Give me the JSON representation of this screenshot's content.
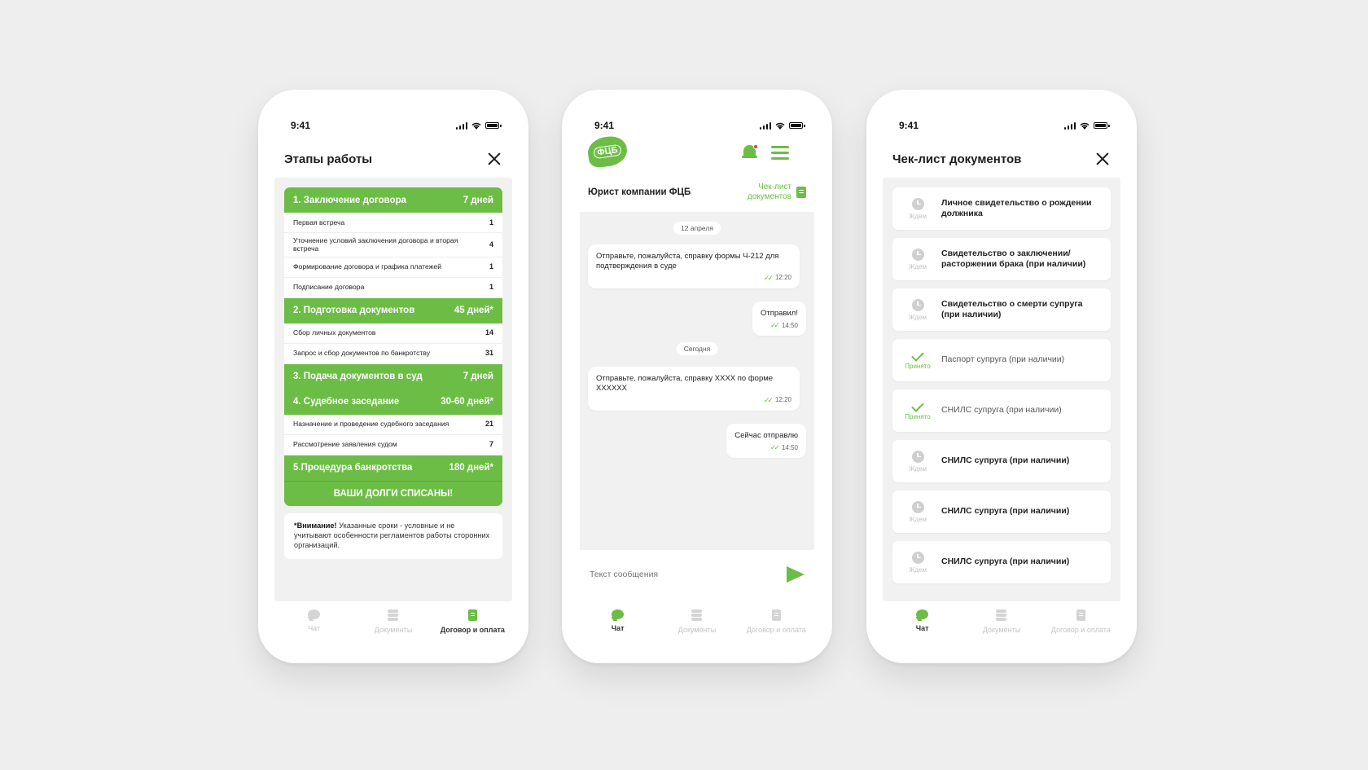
{
  "status": {
    "time": "9:41"
  },
  "tabs": {
    "chat": "Чат",
    "documents": "Документы",
    "contract": "Договор и оплата"
  },
  "stages_screen": {
    "title": "Этапы работы",
    "stages": [
      {
        "title": "1. Заключение договора",
        "days": "7 дней",
        "rows": [
          {
            "label": "Первая встреча",
            "n": "1"
          },
          {
            "label": "Уточнение условий заключения договора и вторая встреча",
            "n": "4"
          },
          {
            "label": "Формирование договора и графика платежей",
            "n": "1"
          },
          {
            "label": "Подписание договора",
            "n": "1"
          }
        ]
      },
      {
        "title": "2. Подготовка документов",
        "days": "45 дней*",
        "rows": [
          {
            "label": "Сбор личных документов",
            "n": "14"
          },
          {
            "label": "Запрос и сбор документов по банкротству",
            "n": "31"
          }
        ]
      },
      {
        "title": "3. Подача документов в суд",
        "days": "7 дней",
        "rows": []
      },
      {
        "title": "4. Судебное заседание",
        "days": "30-60 дней*",
        "rows": [
          {
            "label": "Назначение и проведение судебного заседания",
            "n": "21"
          },
          {
            "label": "Рассмотрение заявления судом",
            "n": "7"
          }
        ]
      },
      {
        "title": "5.Процедура банкротства",
        "days": "180 дней*",
        "rows": []
      }
    ],
    "final": "ВАШИ ДОЛГИ СПИСАНЫ!",
    "note_bold": "*Внимание!",
    "note_text": " Указанные сроки - условные и не учитывают особенности  регламентов работы сторонних организаций."
  },
  "chat_screen": {
    "logo": "ФЦБ",
    "subtitle": "Юрист компании ФЦБ",
    "checklist_link": "Чек-лист документов",
    "date1": "12 апреля",
    "msg1": "Отправьте, пожалуйста, справку формы Ч-212 для подтверждения в суде",
    "msg1_time": "12:20",
    "msg2": "Отправил!",
    "msg2_time": "14:50",
    "date2": "Сегодня",
    "msg3": "Отправьте, пожалуйста, справку ХХХХ по форме ХХХХХХ",
    "msg3_time": "12:20",
    "msg4": "Сейчас отправлю",
    "msg4_time": "14:50",
    "input_placeholder": "Текст сообщения"
  },
  "checklist_screen": {
    "title": "Чек-лист документов",
    "items": [
      {
        "status": "wait",
        "status_label": "Ждем",
        "text": "Личное свидетельство о рождении должника"
      },
      {
        "status": "wait",
        "status_label": "Ждем",
        "text": "Свидетельство о заключении/ расторжении брака (при наличии)"
      },
      {
        "status": "wait",
        "status_label": "Ждем",
        "text": "Свидетельство о смерти супруга (при наличии)"
      },
      {
        "status": "ok",
        "status_label": "Принято",
        "text": "Паспорт супруга (при наличии)"
      },
      {
        "status": "ok",
        "status_label": "Принято",
        "text": "СНИЛС супруга (при наличии)"
      },
      {
        "status": "wait",
        "status_label": "Ждем",
        "text": "СНИЛС супруга (при наличии)"
      },
      {
        "status": "wait",
        "status_label": "Ждем",
        "text": "СНИЛС супруга (при наличии)"
      },
      {
        "status": "wait",
        "status_label": "Ждем",
        "text": "СНИЛС супруга (при наличии)"
      }
    ]
  },
  "colors": {
    "accent": "#6cbd45",
    "background": "#eeeeee"
  }
}
